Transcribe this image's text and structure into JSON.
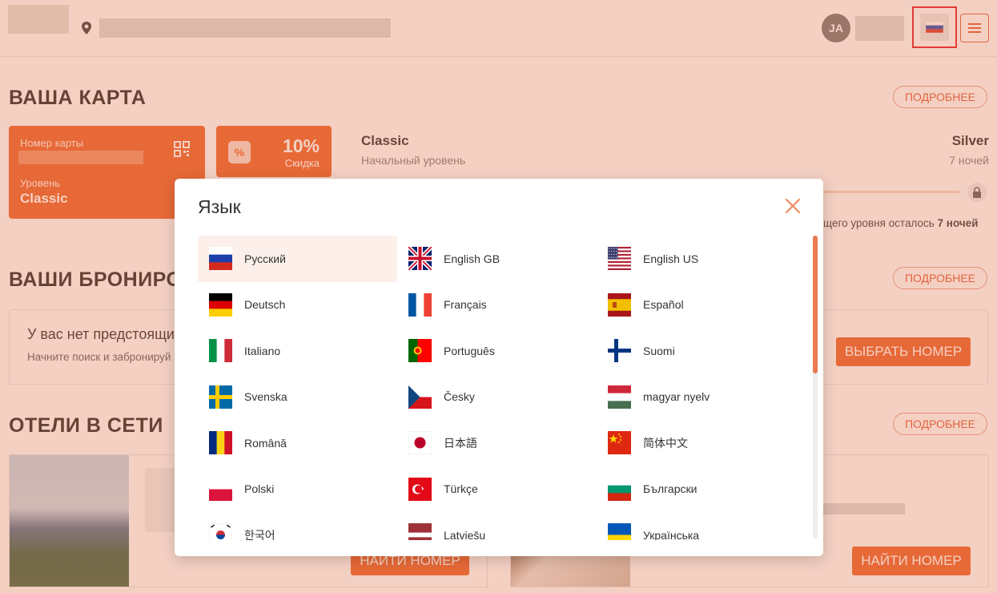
{
  "header": {
    "avatar_initials": "JA",
    "menu_icon": "hamburger-icon",
    "location_icon": "map-pin-icon",
    "current_language_flag": "flag-ru"
  },
  "card_section": {
    "title": "ВАША КАРТА",
    "more_label": "ПОДРОБНЕЕ",
    "card_number_label": "Номер карты",
    "level_label": "Уровень",
    "level_value": "Classic",
    "discount_value": "10%",
    "discount_label": "Скидка",
    "current_level_name": "Classic",
    "current_level_sub": "Начальный уровень",
    "next_level_name": "Silver",
    "next_level_sub": "7 ночей",
    "remaining_text": "щего уровня осталось",
    "remaining_value": "7 ночей",
    "progress": 0
  },
  "bookings_section": {
    "title": "ВАШИ БРОНИРО",
    "more_label": "ПОДРОБНЕЕ",
    "empty_title": "У вас нет предстоящи",
    "empty_sub": "Начните поиск и забронируй",
    "choose_button": "ВЫБРАТЬ НОМЕР"
  },
  "hotels_section": {
    "title": "ОТЕЛИ В СЕТИ",
    "more_label": "ПОДРОБНЕЕ",
    "find_button_1": "НАЙТИ НОМЕР",
    "find_button_2": "НАЙТИ НОМЕР"
  },
  "language_modal": {
    "title": "Язык",
    "selected": "Русский",
    "languages": [
      {
        "label": "Русский",
        "flag": "ru"
      },
      {
        "label": "English GB",
        "flag": "gb"
      },
      {
        "label": "English US",
        "flag": "us"
      },
      {
        "label": "Deutsch",
        "flag": "de"
      },
      {
        "label": "Français",
        "flag": "fr"
      },
      {
        "label": "Español",
        "flag": "es"
      },
      {
        "label": "Italiano",
        "flag": "it"
      },
      {
        "label": "Português",
        "flag": "pt"
      },
      {
        "label": "Suomi",
        "flag": "fi"
      },
      {
        "label": "Svenska",
        "flag": "se"
      },
      {
        "label": "Česky",
        "flag": "cz"
      },
      {
        "label": "magyar nyelv",
        "flag": "hu"
      },
      {
        "label": "Română",
        "flag": "ro"
      },
      {
        "label": "日本語",
        "flag": "jp"
      },
      {
        "label": "简体中文",
        "flag": "cn"
      },
      {
        "label": "Polski",
        "flag": "pl"
      },
      {
        "label": "Türkçe",
        "flag": "tr"
      },
      {
        "label": "Български",
        "flag": "bg"
      },
      {
        "label": "한국어",
        "flag": "kr"
      },
      {
        "label": "Latviešu",
        "flag": "lv"
      },
      {
        "label": "Українська",
        "flag": "ua"
      }
    ]
  },
  "colors": {
    "accent": "#ea5a1d",
    "overlay": "#e18460",
    "selected_bg": "#fdf0eb",
    "highlight_border": "#e0101a"
  }
}
